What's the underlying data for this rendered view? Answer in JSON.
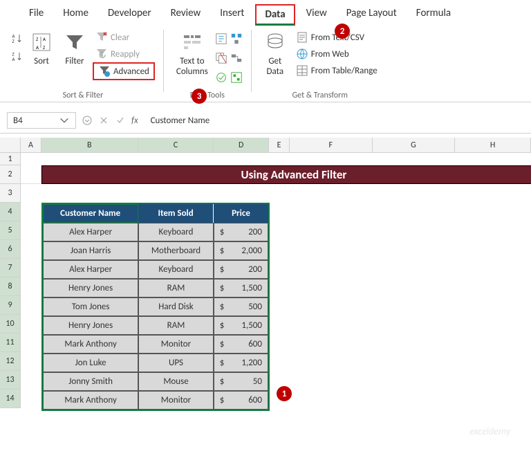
{
  "tabs": [
    "File",
    "Home",
    "Developer",
    "Review",
    "Insert",
    "Data",
    "View",
    "Page Layout",
    "Formula"
  ],
  "active_tab": "Data",
  "ribbon": {
    "sort": "Sort",
    "filter": "Filter",
    "clear": "Clear",
    "reapply": "Reapply",
    "advanced": "Advanced",
    "group_sortfilter": "Sort & Filter",
    "text_to_columns": "Text to\nColumns",
    "group_datatools": "Data Tools",
    "get_data": "Get\nData",
    "from_csv": "From Text/CSV",
    "from_web": "From Web",
    "from_table": "From Table/Range",
    "group_transform": "Get & Transform"
  },
  "namebox": "B4",
  "formula": "Customer Name",
  "cols": {
    "A": 30,
    "B": 140,
    "C": 110,
    "D": 80,
    "E": 30,
    "F": 120,
    "G": 120,
    "H": 110
  },
  "banner_title": "Using Advanced Filter",
  "table": {
    "headers": [
      "Customer Name",
      "Item Sold",
      "Price"
    ],
    "rows": [
      {
        "name": "Alex Harper",
        "item": "Keyboard",
        "price": "200"
      },
      {
        "name": "Joan Harris",
        "item": "Motherboard",
        "price": "2,000"
      },
      {
        "name": "Alex Harper",
        "item": "Keyboard",
        "price": "200"
      },
      {
        "name": "Henry Jones",
        "item": "RAM",
        "price": "1,500"
      },
      {
        "name": "Tom Jones",
        "item": "Hard Disk",
        "price": "500"
      },
      {
        "name": "Henry Jones",
        "item": "RAM",
        "price": "1,500"
      },
      {
        "name": "Mark Anthony",
        "item": "Monitor",
        "price": "600"
      },
      {
        "name": "Jon Luke",
        "item": "UPS",
        "price": "1,200"
      },
      {
        "name": "Jonny Smith",
        "item": "Mouse",
        "price": "50"
      },
      {
        "name": "Mark Anthony",
        "item": "Monitor",
        "price": "600"
      }
    ]
  },
  "annotations": {
    "1": "1",
    "2": "2",
    "3": "3"
  },
  "watermark": "exceldemy"
}
